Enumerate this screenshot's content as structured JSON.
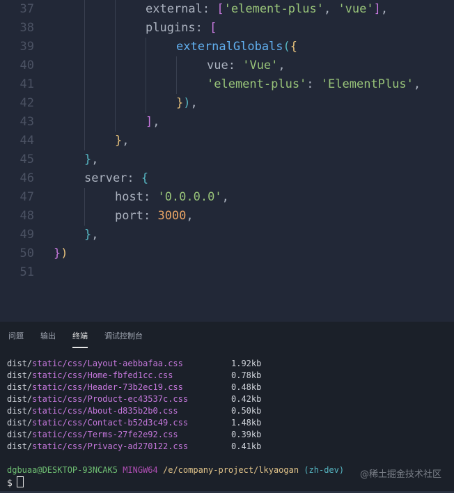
{
  "editor": {
    "lines": [
      {
        "n": "37"
      },
      {
        "n": "38"
      },
      {
        "n": "39"
      },
      {
        "n": "40"
      },
      {
        "n": "41"
      },
      {
        "n": "42"
      },
      {
        "n": "43"
      },
      {
        "n": "44"
      },
      {
        "n": "45"
      },
      {
        "n": "46"
      },
      {
        "n": "47"
      },
      {
        "n": "48"
      },
      {
        "n": "49"
      },
      {
        "n": "50"
      },
      {
        "n": "51"
      }
    ],
    "tokens": {
      "external": "external",
      "colon": ":",
      "lbr": "[",
      "rbr": "]",
      "ep": "'element-plus'",
      "comma": ",",
      "vue": "'vue'",
      "plugins": "plugins",
      "externalGlobals": "externalGlobals",
      "lparen": "(",
      "rparen": ")",
      "lbrace": "{",
      "rbrace": "}",
      "vueKey": "vue",
      "VueVal": "'Vue'",
      "epKey": "'element-plus'",
      "EPVal": "'ElementPlus'",
      "server": "server",
      "host": "host",
      "hostVal": "'0.0.0.0'",
      "port": "port",
      "portVal": "3000"
    }
  },
  "panel": {
    "tabs": [
      "问题",
      "输出",
      "终端",
      "调试控制台"
    ],
    "active_tab": "终端",
    "files": [
      {
        "pre": "dist/",
        "path": "static/css/Layout-aebbafaa.css",
        "size": "1.92kb"
      },
      {
        "pre": "dist/",
        "path": "static/css/Home-fbfed1cc.css",
        "size": "0.78kb"
      },
      {
        "pre": "dist/",
        "path": "static/css/Header-73b2ec19.css",
        "size": "0.48kb"
      },
      {
        "pre": "dist/",
        "path": "static/css/Product-ec43537c.css",
        "size": "0.42kb"
      },
      {
        "pre": "dist/",
        "path": "static/css/About-d835b2b0.css",
        "size": "0.50kb"
      },
      {
        "pre": "dist/",
        "path": "static/css/Contact-b52d3c49.css",
        "size": "1.48kb"
      },
      {
        "pre": "dist/",
        "path": "static/css/Terms-27fe2e92.css",
        "size": "0.39kb"
      },
      {
        "pre": "dist/",
        "path": "static/css/Privacy-ad270122.css",
        "size": "0.41kb"
      }
    ],
    "prompt": {
      "user": "dgbuaa@DESKTOP-93NCAK5",
      "shell": "MINGW64",
      "path": "/e/company-project/lkyaogan",
      "branch": "(zh-dev)"
    },
    "dollar": "$",
    "watermark": "@稀土掘金技术社区"
  }
}
